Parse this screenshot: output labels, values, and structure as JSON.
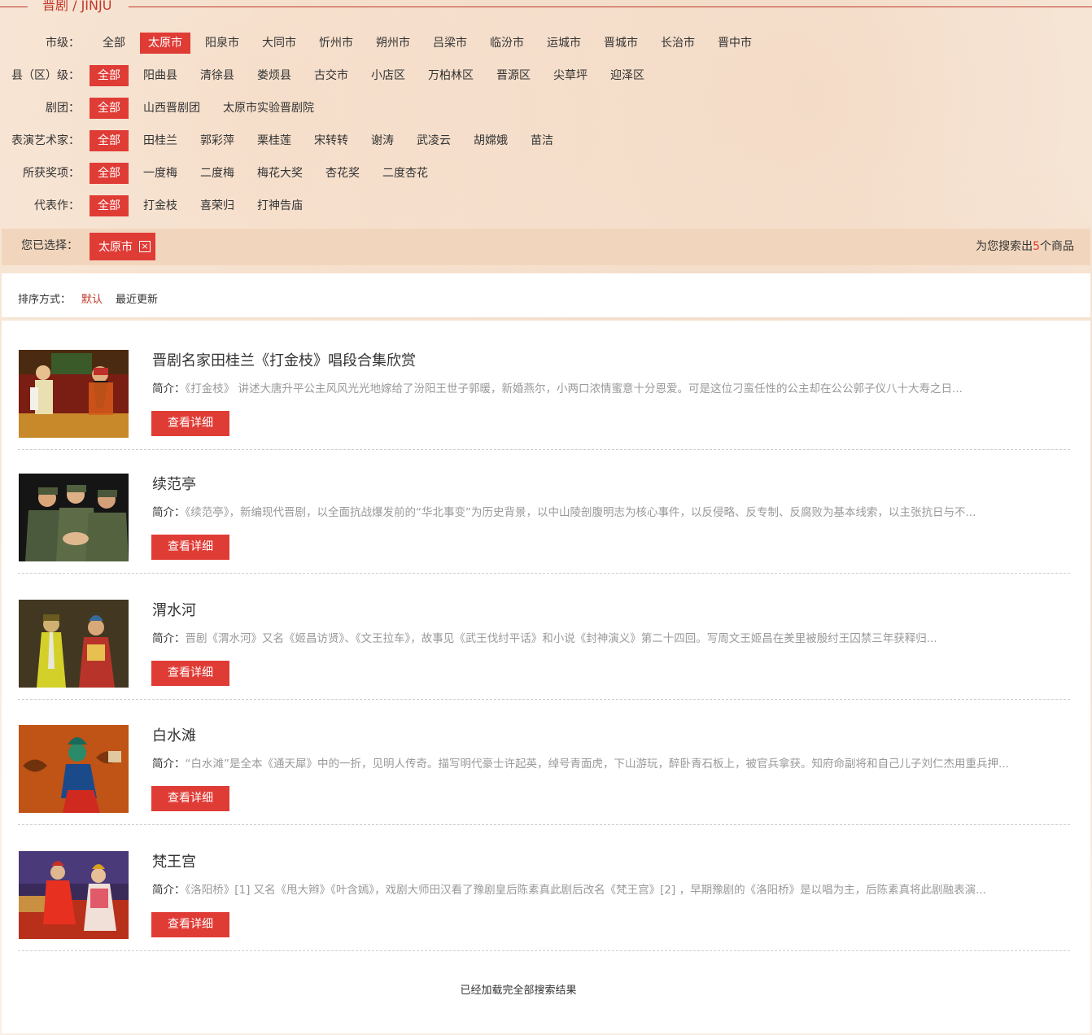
{
  "header": {
    "title": "晋剧 / JINJU"
  },
  "filters": [
    {
      "label": "市级：",
      "active": 1,
      "options": [
        "全部",
        "太原市",
        "阳泉市",
        "大同市",
        "忻州市",
        "朔州市",
        "吕梁市",
        "临汾市",
        "运城市",
        "晋城市",
        "长治市",
        "晋中市"
      ]
    },
    {
      "label": "县（区）级：",
      "active": 0,
      "options": [
        "全部",
        "阳曲县",
        "清徐县",
        "娄烦县",
        "古交市",
        "小店区",
        "万柏林区",
        "晋源区",
        "尖草坪",
        "迎泽区"
      ]
    },
    {
      "label": "剧团：",
      "active": 0,
      "options": [
        "全部",
        "山西晋剧团",
        "太原市实验晋剧院"
      ]
    },
    {
      "label": "表演艺术家：",
      "active": 0,
      "options": [
        "全部",
        "田桂兰",
        "郭彩萍",
        "栗桂莲",
        "宋转转",
        "谢涛",
        "武凌云",
        "胡嫦娥",
        "苗洁"
      ]
    },
    {
      "label": "所获奖项：",
      "active": 0,
      "options": [
        "全部",
        "一度梅",
        "二度梅",
        "梅花大奖",
        "杏花奖",
        "二度杏花"
      ]
    },
    {
      "label": "代表作：",
      "active": 0,
      "options": [
        "全部",
        "打金枝",
        "喜荣归",
        "打神告庙"
      ]
    }
  ],
  "selection": {
    "label": "您已选择：",
    "tag": "太原市",
    "tag_close": "×",
    "count_prefix": "为您搜索出",
    "count": "5",
    "count_suffix": "个商品"
  },
  "sort": {
    "label": "排序方式：",
    "options": [
      "默认",
      "最近更新"
    ],
    "active": 0
  },
  "items": [
    {
      "title": "晋剧名家田桂兰《打金枝》唱段合集欣赏",
      "desc_label": "简介：",
      "desc": "《打金枝》 讲述大唐升平公主风风光光地嫁给了汾阳王世子郭暖，新婚燕尔，小两口浓情蜜意十分恩爱。可是这位刁蛮任性的公主却在公公郭子仪八十大寿之日...",
      "button": "查看详细"
    },
    {
      "title": "续范亭",
      "desc_label": "简介：",
      "desc": "《续范亭》，新编现代晋剧，以全面抗战爆发前的“华北事变”为历史背景，以中山陵剖腹明志为核心事件，以反侵略、反专制、反腐败为基本线索，以主张抗日与不...",
      "button": "查看详细"
    },
    {
      "title": "渭水河",
      "desc_label": "简介：",
      "desc": "晋剧《渭水河》又名《姬昌访贤》、《文王拉车》，故事见《武王伐纣平话》和小说《封神演义》第二十四回。写周文王姬昌在羑里被殷纣王囚禁三年获释归...",
      "button": "查看详细"
    },
    {
      "title": "白水滩",
      "desc_label": "简介：",
      "desc": "“白水滩”是全本《通天犀》中的一折，见明人传奇。描写明代豪士许起英，绰号青面虎，下山游玩，醉卧青石板上，被官兵拿获。知府命副将和自己儿子刘仁杰用重兵押...",
      "button": "查看详细"
    },
    {
      "title": "梵王宫",
      "desc_label": "简介：",
      "desc": "《洛阳桥》[1] 又名《甩大辫》《叶含嫣》，戏剧大师田汉看了豫剧皇后陈素真此剧后改名《梵王宫》[2] ，早期豫剧的《洛阳桥》是以唱为主，后陈素真将此剧融表演...",
      "button": "查看详细"
    }
  ],
  "footer": {
    "end_text": "已经加载完全部搜索结果"
  },
  "colors": {
    "accent": "#e03c36",
    "title": "#c0392b",
    "selected_bar": "#f1d6bd"
  }
}
